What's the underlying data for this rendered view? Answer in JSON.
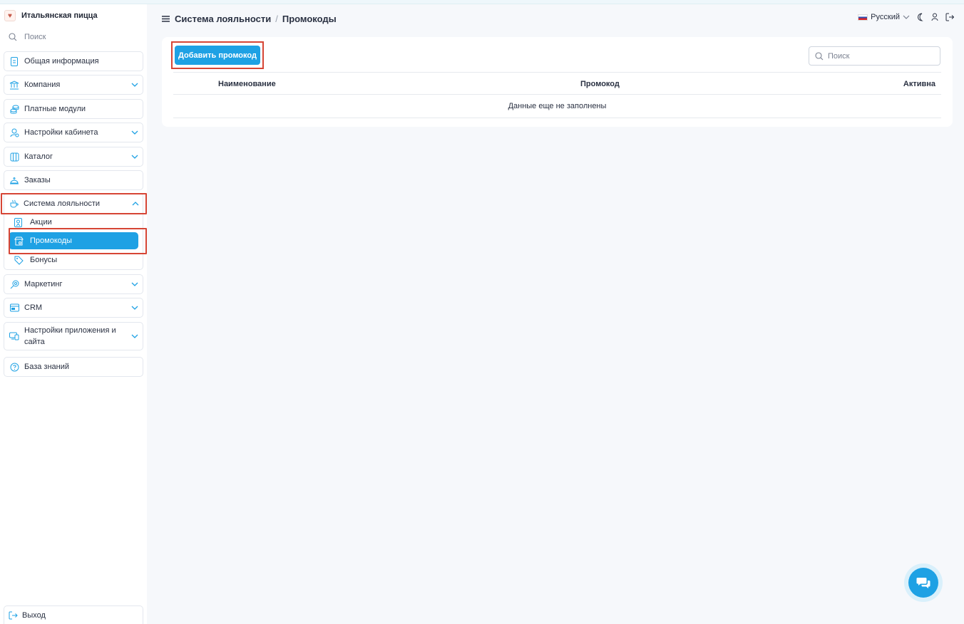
{
  "brand": {
    "name": "Итальянская пицца",
    "logo_icon": "pizza-logo-icon"
  },
  "sidebar": {
    "search_label": "Поиск",
    "items": [
      {
        "label": "Общая информация",
        "icon": "document-icon",
        "has_chevron": false
      },
      {
        "label": "Компания",
        "icon": "bank-icon",
        "has_chevron": true
      },
      {
        "label": "Платные модули",
        "icon": "coins-icon",
        "has_chevron": false
      },
      {
        "label": "Настройки кабинета",
        "icon": "user-settings-icon",
        "has_chevron": true
      },
      {
        "label": "Каталог",
        "icon": "book-icon",
        "has_chevron": true
      },
      {
        "label": "Заказы",
        "icon": "cloche-icon",
        "has_chevron": false
      },
      {
        "label": "Система лояльности",
        "icon": "cup-icon",
        "has_chevron": true,
        "expanded": true
      },
      {
        "label": "Маркетинг",
        "icon": "megaphone-icon",
        "has_chevron": true
      },
      {
        "label": "CRM",
        "icon": "crm-icon",
        "has_chevron": true
      },
      {
        "label": "Настройки приложения и сайта",
        "icon": "app-settings-icon",
        "has_chevron": true
      },
      {
        "label": "База знаний",
        "icon": "help-icon",
        "has_chevron": false
      }
    ],
    "loyalty_sub": [
      {
        "label": "Акции",
        "icon": "badge-icon"
      },
      {
        "label": "Промокоды",
        "icon": "promo-icon",
        "active": true
      },
      {
        "label": "Бонусы",
        "icon": "tag-icon"
      }
    ],
    "logout_label": "Выход"
  },
  "header": {
    "section": "Система лояльности",
    "separator": "/",
    "page": "Промокоды",
    "language": "Русский"
  },
  "card": {
    "add_button": "Добавить промокод",
    "search_placeholder": "Поиск",
    "columns": [
      "Наименование",
      "Промокод",
      "Активна"
    ],
    "empty_text": "Данные еще не заполнены"
  },
  "colors": {
    "accent": "#1ea1e4",
    "highlight": "#d64535",
    "background": "#f6f8fb"
  }
}
